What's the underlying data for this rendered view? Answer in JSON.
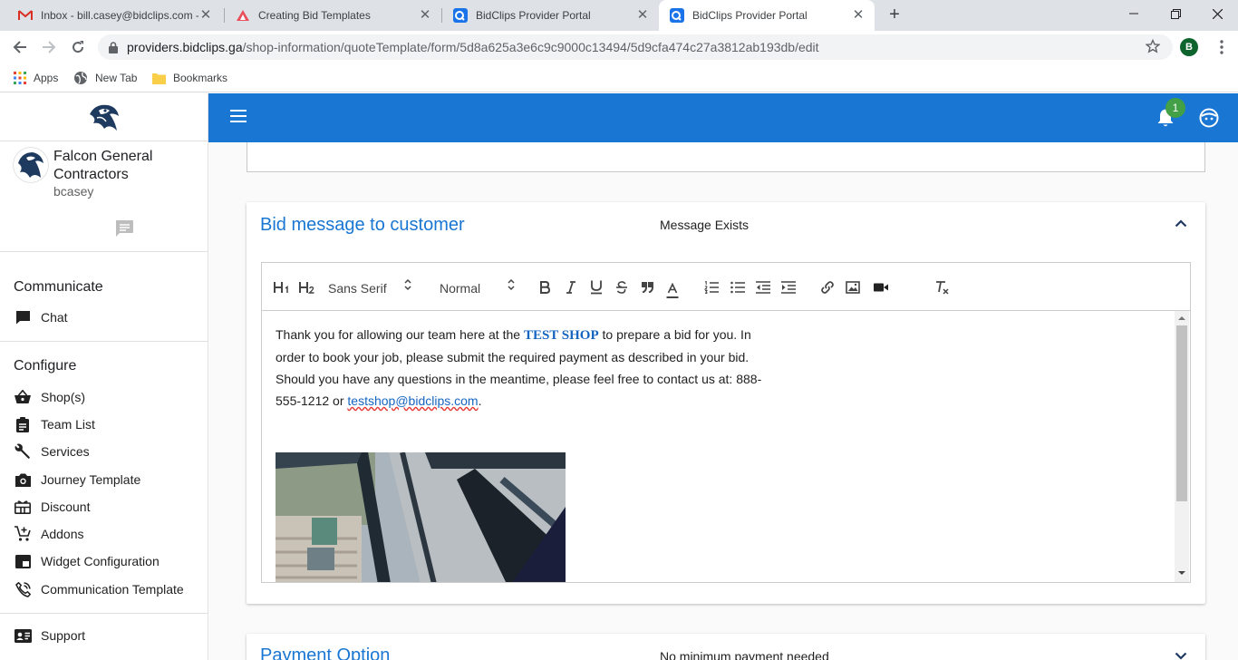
{
  "browser": {
    "tabs": [
      {
        "title": "Inbox - bill.casey@bidclips.com -",
        "icon": "gmail-icon"
      },
      {
        "title": "Creating Bid Templates",
        "icon": "document-icon"
      },
      {
        "title": "BidClips Provider Portal",
        "icon": "bidclips-icon"
      },
      {
        "title": "BidClips Provider Portal",
        "icon": "bidclips-icon",
        "active": true
      }
    ],
    "url_host": "providers.bidclips.ga",
    "url_path": "/shop-information/quoteTemplate/form/5d8a625a3e6c9c9000c13494/5d9cfa474c27a3812ab193db/edit",
    "profile_initial": "B",
    "bookmarks": [
      "Apps",
      "New Tab",
      "Bookmarks"
    ]
  },
  "sidebar": {
    "company": "Falcon General Contractors",
    "username": "bcasey",
    "sections": {
      "communicate": "Communicate",
      "configure": "Configure"
    },
    "communicate_items": [
      {
        "label": "Chat",
        "icon": "chat-icon"
      }
    ],
    "configure_items": [
      {
        "label": "Shop(s)",
        "icon": "basket-icon"
      },
      {
        "label": "Team List",
        "icon": "clipboard-icon"
      },
      {
        "label": "Services",
        "icon": "wrench-icon"
      },
      {
        "label": "Journey Template",
        "icon": "camera-icon"
      },
      {
        "label": "Discount",
        "icon": "gift-icon"
      },
      {
        "label": "Addons",
        "icon": "cart-plus-icon"
      },
      {
        "label": "Widget Configuration",
        "icon": "widget-icon"
      },
      {
        "label": "Communication Template",
        "icon": "phone-icon"
      }
    ],
    "support": {
      "label": "Support",
      "icon": "contact-card-icon"
    }
  },
  "header": {
    "notification_count": "1"
  },
  "bid_message_card": {
    "title": "Bid message to customer",
    "status": "Message Exists",
    "toolbar": {
      "font": "Sans Serif",
      "size": "Normal",
      "h1": "H1",
      "h2": "H2"
    },
    "message": {
      "before_shop": "Thank you for allowing our team here at the ",
      "shop": "TEST SHOP",
      "after_shop": " to prepare a bid for you.  In order to book your job, please submit the required payment as described in your bid. Should you have any questions in the meantime, please feel free to contact us at: 888-555-1212 or ",
      "email": "testshop@bidclips.com",
      "end": "."
    }
  },
  "payment_card": {
    "title": "Payment Option",
    "status": "No minimum payment needed"
  },
  "colors": {
    "primary": "#1976d2",
    "badge": "#43a047",
    "brand_tab": "#1a73e8"
  }
}
